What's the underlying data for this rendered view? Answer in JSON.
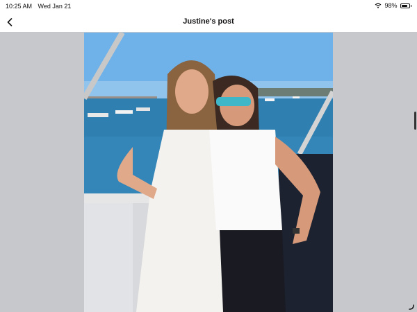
{
  "status_bar": {
    "time": "10:25 AM",
    "date": "Wed Jan 21",
    "battery": "98%",
    "wifi_icon": "wifi-icon",
    "battery_icon": "battery-icon",
    "battery_level": 0.98
  },
  "nav": {
    "title": "Justine's post",
    "back_icon": "chevron-left-icon"
  },
  "post": {
    "photo_subject": "two women on a boat deck"
  },
  "colors": {
    "background": "#c7c8cc",
    "sky": "#7ab6e6",
    "water": "#2f7fb0"
  }
}
